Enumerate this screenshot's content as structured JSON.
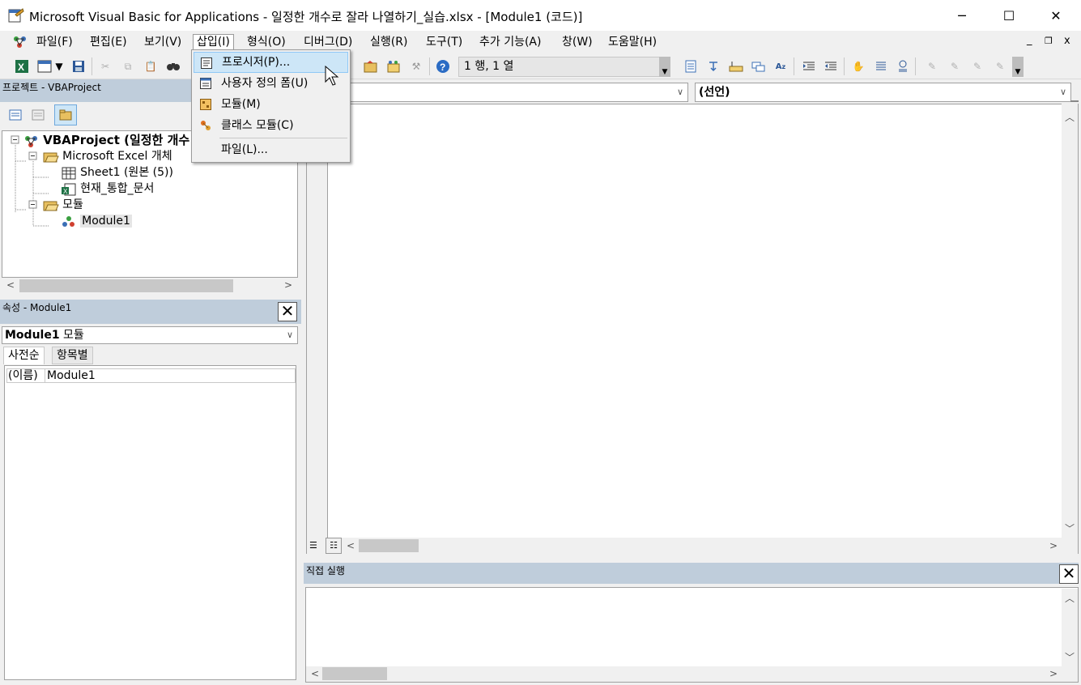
{
  "window": {
    "title": "Microsoft Visual Basic for Applications - 일정한 개수로 잘라 나열하기_실습.xlsx - [Module1 (코드)]",
    "minimize": "─",
    "maximize": "☐",
    "close": "✕"
  },
  "menu": {
    "items": [
      "파일(F)",
      "편집(E)",
      "보기(V)",
      "삽입(I)",
      "형식(O)",
      "디버그(D)",
      "실행(R)",
      "도구(T)",
      "추가 기능(A)",
      "창(W)",
      "도움말(H)"
    ],
    "open_item": "삽입(I)",
    "mdi_min": "_",
    "mdi_restore": "❐",
    "mdi_close": "x"
  },
  "toolbar": {
    "position": "1 행, 1 열"
  },
  "insert_menu": {
    "items": [
      "프로시저(P)...",
      "사용자 정의 폼(U)",
      "모듈(M)",
      "클래스 모듈(C)",
      "파일(L)..."
    ],
    "highlighted": "프로시저(P)..."
  },
  "project_panel": {
    "title": "프로젝트 - VBAProject",
    "tree": {
      "root": "VBAProject (일정한 개수",
      "excel_objects": "Microsoft Excel 개체",
      "sheet1": "Sheet1 (원본 (5))",
      "workbook": "현재_통합_문서",
      "modules_folder": "모듈",
      "module1": "Module1"
    }
  },
  "properties_panel": {
    "title": "속성 - Module1",
    "combo_bold": "Module1",
    "combo_rest": " 모듈",
    "tabs": [
      "사전순",
      "항목별"
    ],
    "rows": [
      {
        "name": "(이름)",
        "value": "Module1"
      }
    ]
  },
  "code_window": {
    "object_combo": ")",
    "procedure_combo": "(선언)"
  },
  "immediate_panel": {
    "title": "직접 실행"
  },
  "colors": {
    "panel_header": "#bfcddb",
    "menu_highlight": "#cde6f7"
  }
}
